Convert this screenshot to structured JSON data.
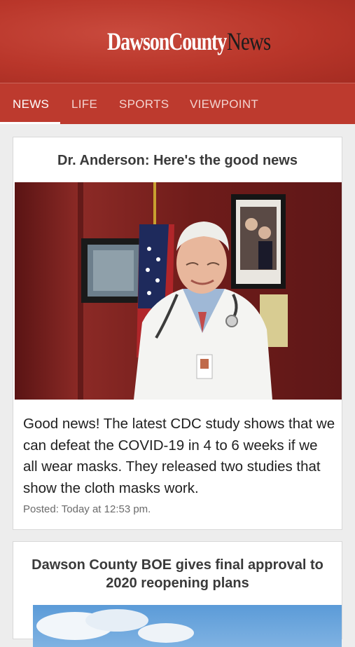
{
  "header": {
    "logo_part1": "DawsonCounty",
    "logo_part2": "News"
  },
  "nav": {
    "tabs": [
      "NEWS",
      "LIFE",
      "SPORTS",
      "VIEWPOINT"
    ],
    "active": "NEWS"
  },
  "articles": [
    {
      "title": "Dr. Anderson: Here's the good news",
      "excerpt": "Good news! The latest CDC study shows that we can defeat the COVID-19 in 4 to 6 weeks if we all wear masks. They released two studies that show the cloth masks work.",
      "posted": "Posted: Today at 12:53 pm."
    },
    {
      "title": "Dawson County BOE gives final approval to 2020 reopening plans"
    }
  ],
  "colors": {
    "brand_red": "#bd3a2e",
    "background": "#ededed"
  }
}
